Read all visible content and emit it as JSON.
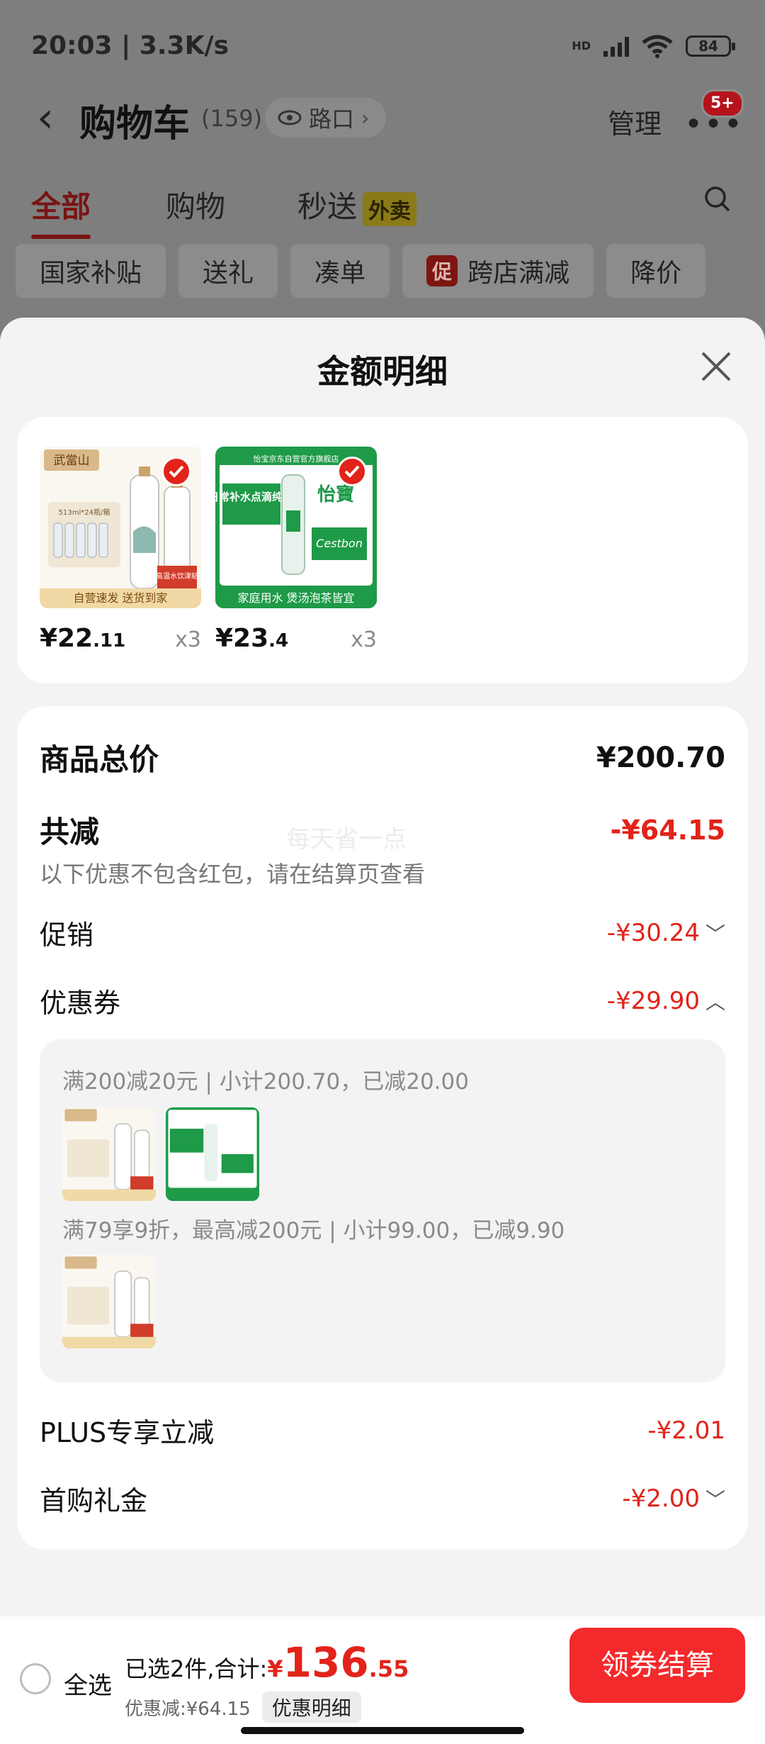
{
  "status_bar": {
    "time_speed": "20:03 | 3.3K/s",
    "network": "HD",
    "battery": "84"
  },
  "cart_header": {
    "title": "购物车",
    "count": "(159)",
    "location": "路口",
    "manage": "管理",
    "badge": "5+"
  },
  "tabs": [
    {
      "label": "全部",
      "active": true
    },
    {
      "label": "购物",
      "active": false
    },
    {
      "label": "秒送",
      "active": false,
      "tag": "外卖"
    }
  ],
  "chips": [
    "国家补贴",
    "送礼",
    "凑单",
    "跨店满减",
    "降价"
  ],
  "chip_promo_icon": "促",
  "sheet": {
    "title": "金额明细",
    "products": [
      {
        "name": "武當山 product",
        "price_int": "¥22",
        "price_dec": ".11",
        "qty": "x3"
      },
      {
        "name": "怡寶 product",
        "price_int": "¥23",
        "price_dec": ".4",
        "qty": "x3"
      }
    ],
    "thumb_text": {
      "brand_a": "武當山",
      "spec_a": "513ml*24瓶/箱",
      "tag_a": "高温水饮津贴",
      "banner_a": "自营速发  送货到家",
      "store_b": "怡宝京东自营官方旗舰店",
      "slogan_b": "日常补水点滴纯净",
      "brand_b": "怡寶",
      "brand_b_en": "Cestbon",
      "banner_b": "家庭用水 煲汤泡茶皆宜"
    },
    "watermark": "每天省一点",
    "total": {
      "label": "商品总价",
      "value": "¥200.70"
    },
    "reduction": {
      "label": "共减",
      "value": "-¥64.15",
      "note": "以下优惠不包含红包，请在结算页查看"
    },
    "promo": {
      "label": "促销",
      "value": "-¥30.24"
    },
    "coupon": {
      "label": "优惠券",
      "value": "-¥29.90",
      "lines": [
        "满200减20元 | 小计200.70，已减20.00",
        "满79享9折，最高减200元 | 小计99.00，已减9.90"
      ]
    },
    "plus": {
      "label": "PLUS专享立减",
      "value": "-¥2.01"
    },
    "first_gift": {
      "label": "首购礼金",
      "value": "-¥2.00"
    }
  },
  "bottom_bar": {
    "select_all": "全选",
    "selected_text": "已选2件,合计:",
    "yen": "¥",
    "amount_int": "136",
    "amount_dec": ".55",
    "discount": "优惠减:¥64.15",
    "detail_button": "优惠明细",
    "checkout": "领券结算"
  }
}
